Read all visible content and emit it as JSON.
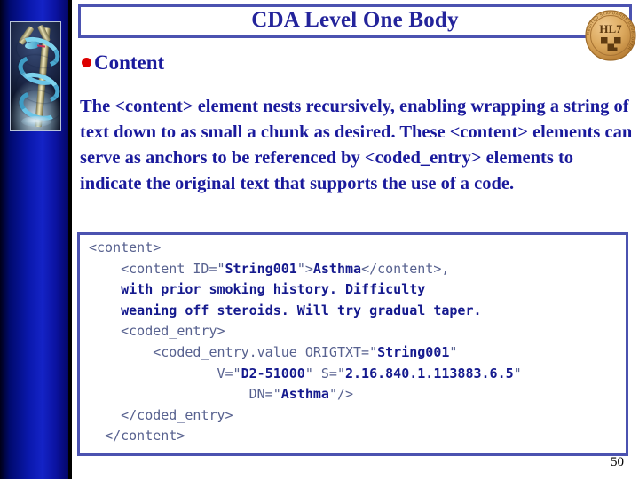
{
  "slide": {
    "title": "CDA Level One Body",
    "slide_number": "50",
    "accent_color": "#4b52b0",
    "text_color": "#1a1a9c",
    "bullet_color": "#dd0000",
    "sidebar_color": "#0a18ac"
  },
  "logo": {
    "name": "hl7-seal",
    "wordmark": "HL7",
    "ring_text": "ACCREDITED STANDARDS DEVELOPER",
    "color": "#d79a4e"
  },
  "sidebar_image": {
    "name": "caduceus-image",
    "alt": "Rod of Asclepius with blue serpent"
  },
  "bullet": {
    "label": "Content"
  },
  "body": {
    "paragraph": "The <content> element nests recursively, enabling wrapping a string of text down to as small a chunk as desired. These <content> elements can serve as anchors to be referenced by <coded_entry> elements to indicate the original text that supports the use of a code."
  },
  "code_block": {
    "language": "xml",
    "lines": [
      {
        "indent": 0,
        "segments": [
          {
            "text": "<content>",
            "bold": false
          }
        ]
      },
      {
        "indent": 2,
        "segments": [
          {
            "text": "<content ID=\"",
            "bold": false
          },
          {
            "text": "String001",
            "bold": true
          },
          {
            "text": "\">",
            "bold": false
          },
          {
            "text": "Asthma",
            "bold": true
          },
          {
            "text": "</content>,",
            "bold": false
          }
        ]
      },
      {
        "indent": 2,
        "segments": [
          {
            "text": "with prior smoking history. Difficulty",
            "bold": true
          }
        ]
      },
      {
        "indent": 2,
        "segments": [
          {
            "text": "weaning off steroids. Will try gradual taper.",
            "bold": true
          }
        ]
      },
      {
        "indent": 2,
        "segments": [
          {
            "text": "<coded_entry>",
            "bold": false
          }
        ]
      },
      {
        "indent": 4,
        "segments": [
          {
            "text": "<coded_entry.value ORIGTXT=\"",
            "bold": false
          },
          {
            "text": "String001",
            "bold": true
          },
          {
            "text": "\"",
            "bold": false
          }
        ]
      },
      {
        "indent": 8,
        "segments": [
          {
            "text": "V=\"",
            "bold": false
          },
          {
            "text": "D2-51000",
            "bold": true
          },
          {
            "text": "\" S=\"",
            "bold": false
          },
          {
            "text": "2.16.840.1.113883.6.5",
            "bold": true
          },
          {
            "text": "\"",
            "bold": false
          }
        ]
      },
      {
        "indent": 10,
        "segments": [
          {
            "text": "DN=\"",
            "bold": false
          },
          {
            "text": "Asthma",
            "bold": true
          },
          {
            "text": "\"/>",
            "bold": false
          }
        ]
      },
      {
        "indent": 2,
        "segments": [
          {
            "text": "</coded_entry>",
            "bold": false
          }
        ]
      },
      {
        "indent": 1,
        "segments": [
          {
            "text": "</content>",
            "bold": false
          }
        ]
      }
    ]
  }
}
